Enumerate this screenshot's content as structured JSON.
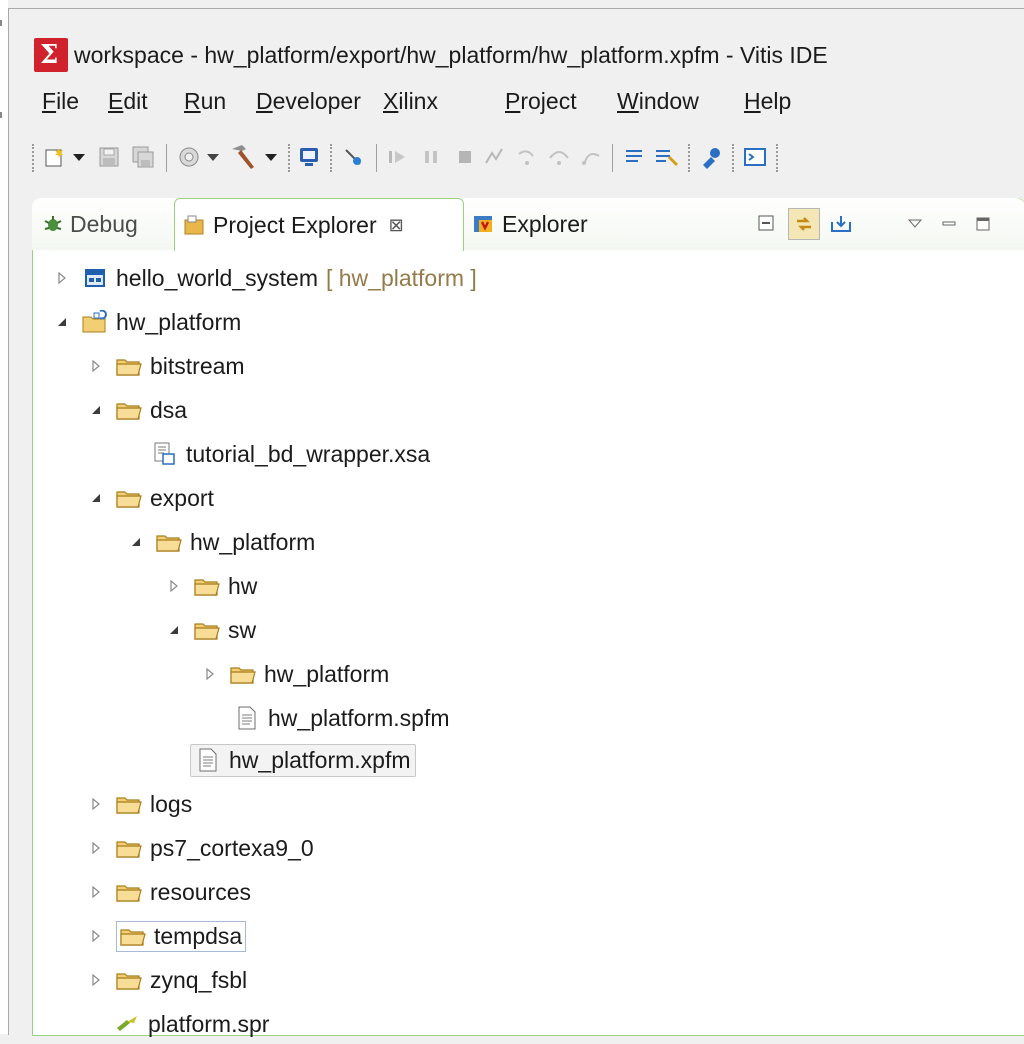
{
  "window": {
    "title": "workspace - hw_platform/export/hw_platform/hw_platform.xpfm - Vitis IDE",
    "logo_letter": "Σ"
  },
  "menu": [
    {
      "label": "File",
      "accel": "F",
      "rest": "ile"
    },
    {
      "label": "Edit",
      "accel": "E",
      "rest": "dit"
    },
    {
      "label": "Run",
      "accel": "R",
      "rest": "un"
    },
    {
      "label": "Developer",
      "accel": "D",
      "rest": "eveloper"
    },
    {
      "label": "Xilinx",
      "accel": "X",
      "rest": "ilinx"
    },
    {
      "label": "Project",
      "accel": "P",
      "rest": "roject"
    },
    {
      "label": "Window",
      "accel": "W",
      "rest": "indow"
    },
    {
      "label": "Help",
      "accel": "H",
      "rest": "elp"
    }
  ],
  "tabs": {
    "debug": "Debug",
    "project_explorer": "Project Explorer",
    "project_explorer_close": "⊠",
    "explorer": "Explorer"
  },
  "tree": {
    "hello_world_system": {
      "label": "hello_world_system",
      "hint": "[ hw_platform ]"
    },
    "hw_platform_root": "hw_platform",
    "bitstream": "bitstream",
    "dsa": "dsa",
    "xsa_file": "tutorial_bd_wrapper.xsa",
    "export": "export",
    "export_hw_platform": "hw_platform",
    "hw": "hw",
    "sw": "sw",
    "sw_hw_platform": "hw_platform",
    "spfm_file": "hw_platform.spfm",
    "xpfm_file": "hw_platform.xpfm",
    "logs": "logs",
    "ps7": "ps7_cortexa9_0",
    "resources": "resources",
    "tempdsa": "tempdsa",
    "zynq_fsbl": "zynq_fsbl",
    "platform_spr": "platform.spr"
  },
  "colors": {
    "folder": "#e8b64a",
    "panel_border": "#9bd37d",
    "hint_text": "#937b4a",
    "logo_red": "#d0222d"
  }
}
